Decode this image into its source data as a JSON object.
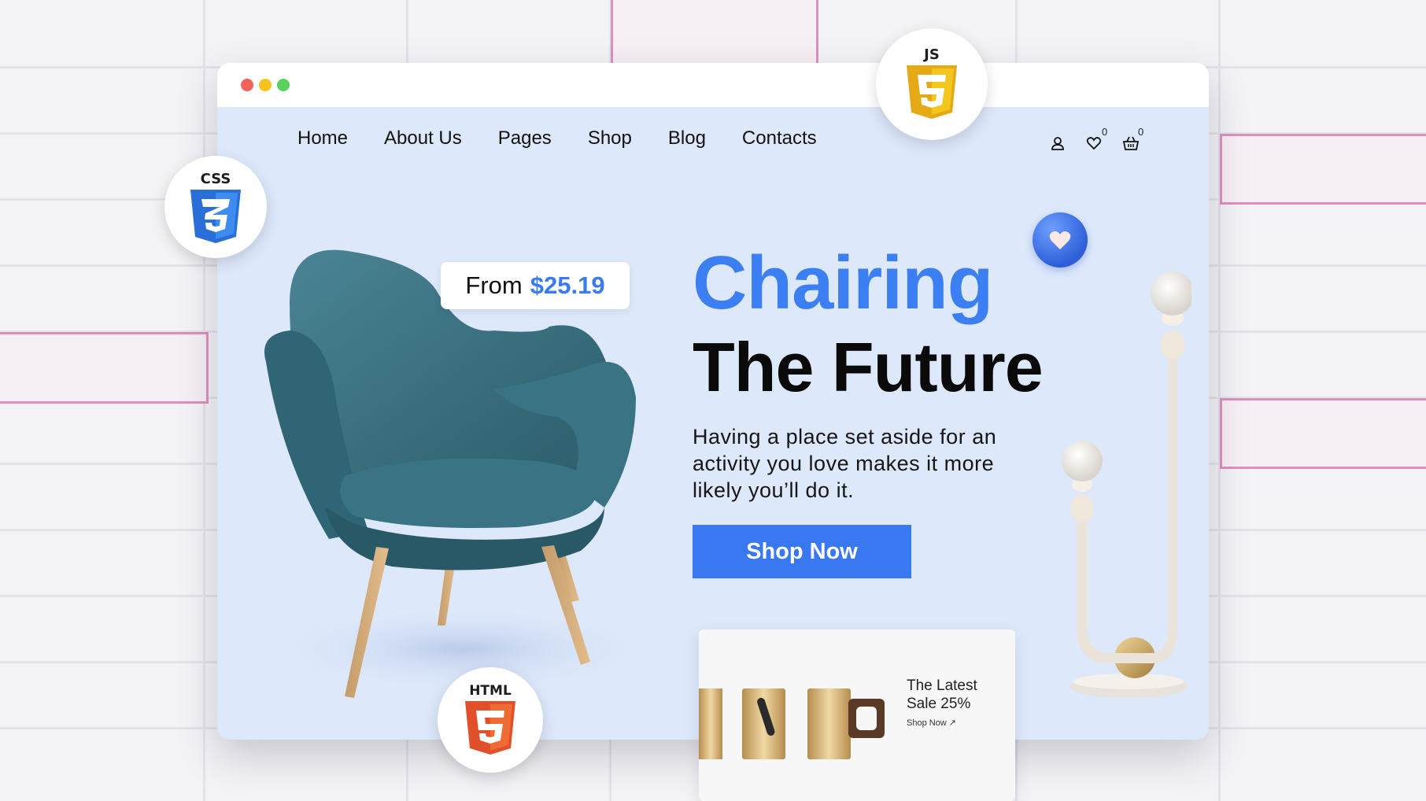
{
  "nav": {
    "items": [
      "Home",
      "About Us",
      "Pages",
      "Shop",
      "Blog",
      "Contacts"
    ],
    "wishlist_count": "0",
    "cart_count": "0"
  },
  "hero": {
    "price_prefix": "From",
    "price": "$25.19",
    "headline_line1": "Chairing",
    "headline_line2": "The Future",
    "description": "Having a place set aside for an activity you love makes it more likely you’ll do it.",
    "cta_label": "Shop Now"
  },
  "promo": {
    "title": "The Latest Sale 25%",
    "link": "Shop Now ↗"
  },
  "badges": {
    "css": "CSS",
    "js": "JS",
    "html": "HTML"
  },
  "colors": {
    "accent": "#3a7bf2",
    "page_bg": "#dde8fb",
    "css_blue": "#2a6ed8",
    "js_yellow": "#f1c31b",
    "html_orange": "#e8552a"
  }
}
